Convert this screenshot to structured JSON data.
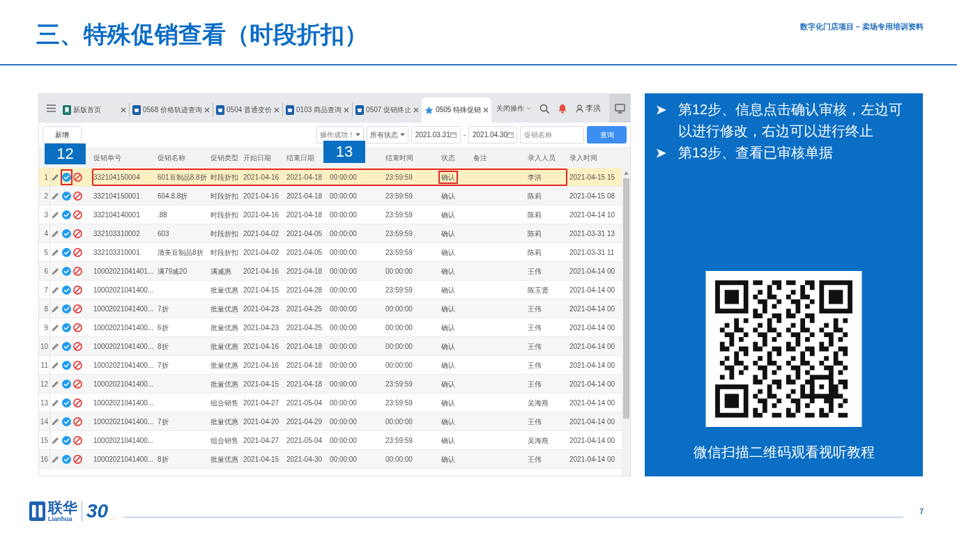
{
  "slide": {
    "title": "三、特殊促销查看（时段折扣）",
    "subtitle": "数字化门店项目 – 卖场专用培训资料",
    "page_number": "7"
  },
  "app": {
    "tabs": [
      {
        "label": "新版首页",
        "kind": "home",
        "selected": false
      },
      {
        "label": "0568 价格轨迹查询",
        "kind": "module",
        "selected": false
      },
      {
        "label": "0504 普通变价",
        "kind": "module",
        "selected": false
      },
      {
        "label": "0103 商品查询",
        "kind": "module",
        "selected": false
      },
      {
        "label": "0507 促销终止",
        "kind": "module",
        "selected": false
      },
      {
        "label": "0505 特殊促销",
        "kind": "starred",
        "selected": true
      }
    ],
    "tab_actions": {
      "close_menu": "关闭操作",
      "user": "李洪"
    },
    "toolbar": {
      "add_button": "新增",
      "toast": "操作成功！",
      "status_filter": "所有状态",
      "date_from": "2021.03.31",
      "date_separator": "-",
      "date_to": "2021.04.30",
      "name_search": {
        "placeholder": "促销名称"
      },
      "query_button": "查询"
    },
    "table": {
      "columns": [
        "促销单号",
        "促销名称",
        "促销类型",
        "开始日期",
        "结束日期",
        "结束时间",
        "状态",
        "备注",
        "录入人员",
        "录入时间"
      ],
      "rows": [
        {
          "number": "1",
          "order_no": "332104150004",
          "name": "601豆制品8.8折",
          "type": "时段折扣",
          "start_date": "2021-04-16",
          "end_date": "2021-04-18",
          "column_6": "00:00:00",
          "end_time": "23:59:59",
          "status": "确认",
          "entered_by": "李洪",
          "entered_at": "2021-04-15 15",
          "selected": true,
          "outlined": true,
          "confirm_outlined": true,
          "status_outlined": true
        },
        {
          "number": "2",
          "order_no": "332104150001",
          "name": "604.8.8折",
          "type": "时段折扣",
          "start_date": "2021-04-16",
          "end_date": "2021-04-18",
          "column_6": "00:00:00",
          "end_time": "23:59:59",
          "status": "确认",
          "entered_by": "陈莉",
          "entered_at": "2021-04-15 08",
          "selected": false,
          "outlined": false,
          "confirm_outlined": false,
          "status_outlined": false
        },
        {
          "number": "3",
          "order_no": "332104140001",
          "name": ".88",
          "type": "时段折扣",
          "start_date": "2021-04-16",
          "end_date": "2021-04-18",
          "column_6": "00:00:00",
          "end_time": "23:59:59",
          "status": "确认",
          "entered_by": "陈莉",
          "entered_at": "2021-04-14 10",
          "selected": false,
          "outlined": false,
          "confirm_outlined": false,
          "status_outlined": false
        },
        {
          "number": "4",
          "order_no": "332103310002",
          "name": "603",
          "type": "时段折扣",
          "start_date": "2021-04-02",
          "end_date": "2021-04-05",
          "column_6": "00:00:00",
          "end_time": "23:59:59",
          "status": "确认",
          "entered_by": "陈莉",
          "entered_at": "2021-03-31 13",
          "selected": false,
          "outlined": false,
          "confirm_outlined": false,
          "status_outlined": false
        },
        {
          "number": "5",
          "order_no": "332103310001",
          "name": "清美豆制品8折",
          "type": "时段折扣",
          "start_date": "2021-04-02",
          "end_date": "2021-04-05",
          "column_6": "00:00:00",
          "end_time": "23:59:59",
          "status": "确认",
          "entered_by": "陈莉",
          "entered_at": "2021-03-31 11",
          "selected": false,
          "outlined": false,
          "confirm_outlined": false,
          "status_outlined": false
        },
        {
          "number": "6",
          "order_no": "10002021041401...",
          "name": "满79减20",
          "type": "满减惠",
          "start_date": "2021-04-16",
          "end_date": "2021-04-18",
          "column_6": "00:00:00",
          "end_time": "00:00:00",
          "status": "确认",
          "entered_by": "王伟",
          "entered_at": "2021-04-14 00",
          "selected": false,
          "outlined": false,
          "confirm_outlined": false,
          "status_outlined": false
        },
        {
          "number": "7",
          "order_no": "10002021041400...",
          "type": "批量优惠",
          "start_date": "2021-04-15",
          "end_date": "2021-04-28",
          "column_6": "00:00:00",
          "end_time": "23:59:59",
          "status": "确认",
          "entered_by": "陈玉贤",
          "entered_at": "2021-04-14 00",
          "selected": false,
          "outlined": false,
          "confirm_outlined": false,
          "status_outlined": false
        },
        {
          "number": "8",
          "order_no": "10002021041400...",
          "name": "7折",
          "type": "批量优惠",
          "start_date": "2021-04-23",
          "end_date": "2021-04-25",
          "column_6": "00:00:00",
          "end_time": "00:00:00",
          "status": "确认",
          "entered_by": "王伟",
          "entered_at": "2021-04-14 00",
          "selected": false,
          "outlined": false,
          "confirm_outlined": false,
          "status_outlined": false
        },
        {
          "number": "9",
          "order_no": "10002021041400...",
          "name": "6折",
          "type": "批量优惠",
          "start_date": "2021-04-23",
          "end_date": "2021-04-25",
          "column_6": "00:00:00",
          "end_time": "00:00:00",
          "status": "确认",
          "entered_by": "王伟",
          "entered_at": "2021-04-14 00",
          "selected": false,
          "outlined": false,
          "confirm_outlined": false,
          "status_outlined": false
        },
        {
          "number": "10",
          "order_no": "10002021041400...",
          "name": "8折",
          "type": "批量优惠",
          "start_date": "2021-04-16",
          "end_date": "2021-04-18",
          "column_6": "00:00:00",
          "end_time": "00:00:00",
          "status": "确认",
          "entered_by": "王伟",
          "entered_at": "2021-04-14 00",
          "selected": false,
          "outlined": false,
          "confirm_outlined": false,
          "status_outlined": false
        },
        {
          "number": "11",
          "order_no": "10002021041400...",
          "name": "7折",
          "type": "批量优惠",
          "start_date": "2021-04-16",
          "end_date": "2021-04-18",
          "column_6": "00:00:00",
          "end_time": "00:00:00",
          "status": "确认",
          "entered_by": "王伟",
          "entered_at": "2021-04-14 00",
          "selected": false,
          "outlined": false,
          "confirm_outlined": false,
          "status_outlined": false
        },
        {
          "number": "12",
          "order_no": "10002021041400...",
          "type": "批量优惠",
          "start_date": "2021-04-15",
          "end_date": "2021-04-18",
          "column_6": "00:00:00",
          "end_time": "23:59:59",
          "status": "确认",
          "entered_by": "王伟",
          "entered_at": "2021-04-14 00",
          "selected": false,
          "outlined": false,
          "confirm_outlined": false,
          "status_outlined": false
        },
        {
          "number": "13",
          "order_no": "10002021041400...",
          "type": "组合销售",
          "start_date": "2021-04-27",
          "end_date": "2021-05-04",
          "column_6": "00:00:00",
          "end_time": "23:59:59",
          "status": "确认",
          "entered_by": "吴海燕",
          "entered_at": "2021-04-14 00",
          "selected": false,
          "outlined": false,
          "confirm_outlined": false,
          "status_outlined": false
        },
        {
          "number": "14",
          "order_no": "10002021041400...",
          "name": "7折",
          "type": "批量优惠",
          "start_date": "2021-04-20",
          "end_date": "2021-04-29",
          "column_6": "00:00:00",
          "end_time": "00:00:00",
          "status": "确认",
          "entered_by": "王伟",
          "entered_at": "2021-04-14 00",
          "selected": false,
          "outlined": false,
          "confirm_outlined": false,
          "status_outlined": false
        },
        {
          "number": "15",
          "order_no": "10002021041400...",
          "type": "组合销售",
          "start_date": "2021-04-27",
          "end_date": "2021-05-04",
          "column_6": "00:00:00",
          "end_time": "23:59:59",
          "status": "确认",
          "entered_by": "吴海燕",
          "entered_at": "2021-04-14 00",
          "selected": false,
          "outlined": false,
          "confirm_outlined": false,
          "status_outlined": false
        },
        {
          "number": "16",
          "order_no": "10002021041400...",
          "name": "8折",
          "type": "批量优惠",
          "start_date": "2021-04-15",
          "end_date": "2021-04-30",
          "column_6": "00:00:00",
          "end_time": "00:00:00",
          "status": "确认",
          "entered_by": "王伟",
          "entered_at": "2021-04-14 00",
          "selected": false,
          "outlined": false,
          "confirm_outlined": false,
          "status_outlined": false
        }
      ]
    }
  },
  "callouts": [
    {
      "label": "12"
    },
    {
      "label": "13"
    }
  ],
  "instructions": {
    "steps": [
      "第12步、信息点击确认审核，左边可以进行修改，右边可以进行终止",
      "第13步、查看已审核单据"
    ],
    "qr_caption": "微信扫描二维码观看视听教程"
  },
  "footer": {
    "logo": {
      "name": "联华",
      "latin": "Lianhua",
      "anniversary": "30"
    }
  }
}
